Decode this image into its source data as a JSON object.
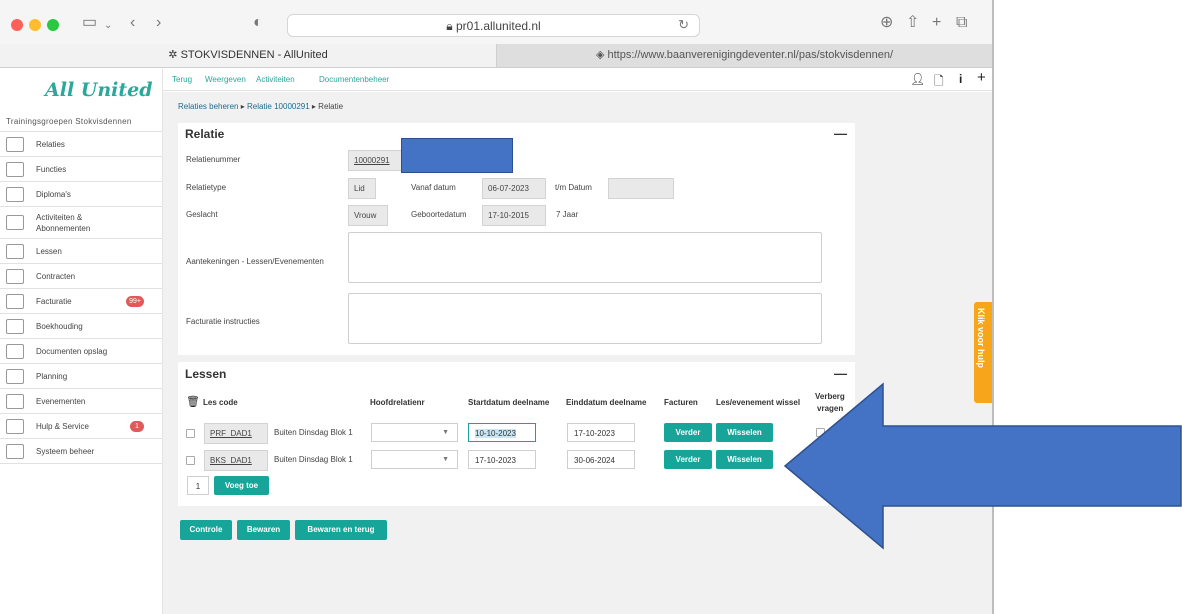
{
  "browser": {
    "url": "pr01.allunited.nl",
    "tabs": [
      {
        "label": "STOKVISDENNEN - AllUnited"
      },
      {
        "label": "https://www.baanverenigingdeventer.nl/pas/stokvisdennen/"
      }
    ]
  },
  "sidebar": {
    "logo": "All United",
    "subtitle": "Trainingsgroepen Stokvisdennen",
    "items": [
      {
        "label": "Relaties",
        "badge": ""
      },
      {
        "label": "Functies",
        "badge": ""
      },
      {
        "label": "Diploma's",
        "badge": ""
      },
      {
        "label": "Activiteiten &",
        "label2": "Abonnementen",
        "badge": ""
      },
      {
        "label": "Lessen",
        "badge": ""
      },
      {
        "label": "Contracten",
        "badge": ""
      },
      {
        "label": "Facturatie",
        "badge": "99+"
      },
      {
        "label": "Boekhouding",
        "badge": ""
      },
      {
        "label": "Documenten opslag",
        "badge": ""
      },
      {
        "label": "Planning",
        "badge": ""
      },
      {
        "label": "Evenementen",
        "badge": ""
      },
      {
        "label": "Hulp & Service",
        "badge": "1"
      },
      {
        "label": "Systeem beheer",
        "badge": ""
      }
    ]
  },
  "topnav": {
    "links": [
      "Terug",
      "Weergeven",
      "Activiteiten",
      "Documentenbeheer"
    ],
    "right_icons": [
      "user-icon",
      "document-icon",
      "info-icon",
      "plus-icon"
    ]
  },
  "breadcrumb": {
    "items": [
      "Relaties beheren",
      "Relatie 10000291",
      "Relatie"
    ],
    "separator": "▸"
  },
  "relatie": {
    "title": "Relatie",
    "collapse": "—",
    "relatienummer_label": "Relatienummer",
    "relatienummer": "10000291",
    "relatietype_label": "Relatietype",
    "relatietype": "Lid",
    "vanaf_label": "Vanaf datum",
    "vanaf": "06-07-2023",
    "tm_label": "t/m Datum",
    "tm": "",
    "geslacht_label": "Geslacht",
    "geslacht": "Vrouw",
    "geboorte_label": "Geboortedatum",
    "geboorte": "17-10-2015",
    "leeftijd": "7 Jaar",
    "aantekeningen_label": "Aantekeningen - Lessen/Evenementen",
    "facturatie_label": "Facturatie instructies"
  },
  "lessen": {
    "title": "Lessen",
    "collapse": "—",
    "headers": {
      "code": "Les code",
      "hoofd": "Hoofdrelatienr",
      "start": "Startdatum deelname",
      "eind": "Einddatum deelname",
      "facturen": "Facturen",
      "wissel": "Les/evenement wissel",
      "verberg": "Verberg",
      "vragen": "vragen"
    },
    "rows": [
      {
        "code": "PRF_DAD1",
        "name": "Buiten Dinsdag Blok 1",
        "start": "10-10-2023",
        "end": "17-10-2023",
        "verder": "Verder",
        "wisselen": "Wisselen"
      },
      {
        "code": "BKS_DAD1",
        "name": "Buiten Dinsdag Blok 1",
        "start": "17-10-2023",
        "end": "30-06-2024",
        "verder": "Verder",
        "wisselen": "Wisselen"
      }
    ],
    "count": "1",
    "add_label": "Voeg toe"
  },
  "actions": {
    "controle": "Controle",
    "bewaren": "Bewaren",
    "bewaren_terug": "Bewaren en terug"
  },
  "help": "Klik voor hulp",
  "colors": {
    "accent": "#17a59a",
    "badge": "#e05a5a",
    "help": "#f7a51b",
    "arrow": "#4472c4"
  }
}
